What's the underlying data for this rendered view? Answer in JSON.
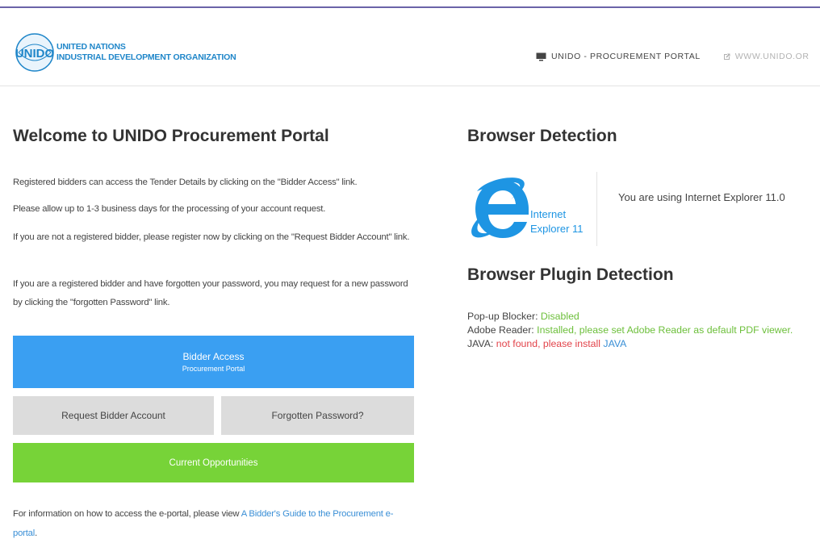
{
  "header": {
    "org_line1": "United Nations",
    "org_line2": "Industrial Development Organization",
    "logo_icon": "un-emblem-icon",
    "logo_text": "UNIDO",
    "nav_portal": "UNIDO - PROCUREMENT PORTAL",
    "nav_portal_icon": "monitor-icon",
    "nav_site": "WWW.UNIDO.OR",
    "nav_site_icon": "external-link-icon"
  },
  "welcome": {
    "title": "Welcome to UNIDO Procurement Portal",
    "p1": "Registered bidders can access the Tender Details by clicking on the \"Bidder Access\" link.",
    "p2": "Please allow up to 1-3 business days for the processing of your account request.",
    "p3": "If you are not a registered bidder, please register now by clicking on the \"Request Bidder Account\" link.",
    "p4": "If you are a registered bidder and have forgotten your password, you may request for a new password by clicking the \"forgotten Password\" link."
  },
  "buttons": {
    "bidder_access": "Bidder Access",
    "bidder_access_sub": "Procurement Portal",
    "request_account": "Request Bidder Account",
    "forgotten_password": "Forgotten Password?",
    "current_opportunities": "Current Opportunities"
  },
  "footnote": {
    "text": "For information on how to access the e-portal, please view ",
    "link": "A Bidder's Guide to the Procurement e-portal",
    "end": "."
  },
  "browser": {
    "title": "Browser Detection",
    "logo_line1": "Internet",
    "logo_line2": "Explorer 11",
    "logo_icon": "internet-explorer-icon",
    "message": "You are using Internet Explorer 11.0"
  },
  "plugins": {
    "title": "Browser Plugin Detection",
    "popup_label": "Pop-up Blocker:",
    "popup_value": "Disabled",
    "reader_label": "Adobe Reader:",
    "reader_value": "Installed, please set Adobe Reader as default PDF viewer.",
    "java_label": "JAVA:",
    "java_value": "not found, please install",
    "java_link": "JAVA"
  },
  "colors": {
    "accent_blue": "#3a9ff2",
    "accent_green": "#77d338",
    "status_ok": "#6cbf3a",
    "status_bad": "#e2434a",
    "link": "#3a8fd6"
  }
}
